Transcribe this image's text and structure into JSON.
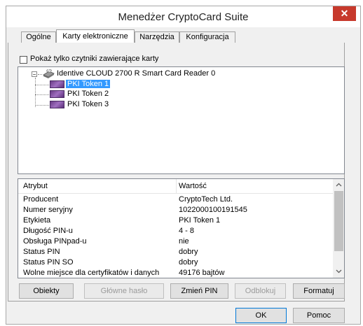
{
  "window": {
    "title": "Menedżer CryptoCard Suite",
    "close_glyph": "✕"
  },
  "tabs": [
    {
      "label": "Ogólne",
      "active": false
    },
    {
      "label": "Karty elektroniczne",
      "active": true
    },
    {
      "label": "Narzędzia",
      "active": false
    },
    {
      "label": "Konfiguracja",
      "active": false
    }
  ],
  "filter": {
    "label": "Pokaż tylko czytniki zawierające karty",
    "checked": false
  },
  "tree": {
    "expander_glyph": "−",
    "reader_label": "Identive CLOUD 2700 R Smart Card Reader 0",
    "tokens": [
      "PKI Token 1",
      "PKI Token 2",
      "PKI Token 3"
    ],
    "selected_token": "PKI Token 1"
  },
  "properties": {
    "headers": {
      "attribute": "Atrybut",
      "value": "Wartość"
    },
    "rows": [
      {
        "attribute": "Producent",
        "value": "CryptoTech Ltd."
      },
      {
        "attribute": "Numer seryjny",
        "value": "1022000100191545"
      },
      {
        "attribute": "Etykieta",
        "value": "PKI Token 1"
      },
      {
        "attribute": "Długość PIN-u",
        "value": "4 - 8"
      },
      {
        "attribute": "Obsługa PINpad-u",
        "value": "nie"
      },
      {
        "attribute": "Status PIN",
        "value": "dobry"
      },
      {
        "attribute": "Status PIN SO",
        "value": "dobry"
      },
      {
        "attribute": "Wolne miejsce dla certyfikatów i danych",
        "value": "49176 bajtów"
      }
    ]
  },
  "actions": {
    "objects": "Obiekty",
    "main_password": "Główne hasło",
    "change_pin": "Zmień PIN",
    "unlock": "Odblokuj",
    "format": "Formatuj"
  },
  "dialog": {
    "ok": "OK",
    "help": "Pomoc"
  },
  "colors": {
    "selection": "#3399ff",
    "close_button": "#c7392c"
  }
}
